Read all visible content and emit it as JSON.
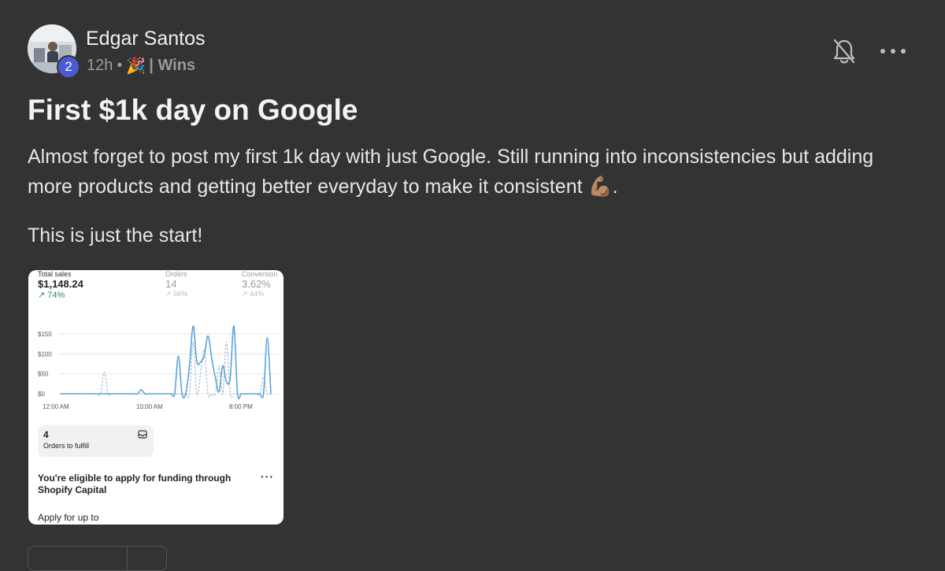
{
  "post": {
    "author": "Edgar Santos",
    "level": "2",
    "time": "12h",
    "separator": "•",
    "category_emoji": "🎉",
    "category": "| Wins",
    "title": "First $1k day on Google",
    "body_line1": "Almost forget to post my first 1k day with just Google. Still running into inconsistencies but adding more products and getting better everyday to make it consistent 💪🏽.",
    "body_line2": "This is just the start!"
  },
  "icons": {
    "bell": "bell-off-icon",
    "more": "more-horizontal-icon",
    "inbox": "inbox-icon"
  },
  "screenshot": {
    "stats": [
      {
        "label": "Total sales",
        "value": "$1,148.24",
        "change": "↗ 74%"
      },
      {
        "label": "Orders",
        "value": "14",
        "change": "↗ 56%"
      },
      {
        "label": "Conversion",
        "value": "3.62%",
        "change": "↗ 44%"
      }
    ],
    "fulfill": {
      "count": "4",
      "label": "Orders to fulfill"
    },
    "capital": {
      "title": "You're eligible to apply for funding through Shopify Capital",
      "more": "···",
      "apply": "Apply for up to"
    }
  },
  "chart_data": {
    "type": "line",
    "ylim": [
      0,
      150
    ],
    "yticks": [
      "$150",
      "$100",
      "$50",
      "$0"
    ],
    "xticks": [
      "12:00 AM",
      "10:00 AM",
      "8:00 PM"
    ],
    "series": [
      {
        "name": "",
        "style": "solid",
        "color": "#5ba4d8",
        "values": [
          0,
          0,
          0,
          0,
          0,
          0,
          0,
          0,
          0,
          0,
          0,
          0,
          0,
          0,
          0,
          0,
          0,
          0,
          0,
          0,
          0,
          0,
          10,
          0,
          0,
          0,
          0,
          0,
          0,
          0,
          0,
          0,
          95,
          0,
          0,
          70,
          170,
          80,
          80,
          95,
          145,
          90,
          40,
          5,
          70,
          30,
          40,
          175,
          0,
          0,
          0,
          0,
          0,
          0,
          0,
          0,
          140,
          0
        ]
      },
      {
        "name": "",
        "style": "dashed",
        "color": "#9fb8cc",
        "values": [
          0,
          0,
          0,
          0,
          0,
          0,
          0,
          0,
          0,
          0,
          0,
          0,
          55,
          0,
          0,
          0,
          0,
          0,
          0,
          0,
          0,
          0,
          0,
          0,
          0,
          0,
          0,
          0,
          0,
          0,
          0,
          0,
          0,
          0,
          0,
          0,
          130,
          0,
          50,
          110,
          0,
          0,
          0,
          70,
          0,
          130,
          0,
          0,
          0,
          0,
          0,
          0,
          0,
          0,
          0,
          40,
          0,
          0
        ]
      }
    ]
  }
}
